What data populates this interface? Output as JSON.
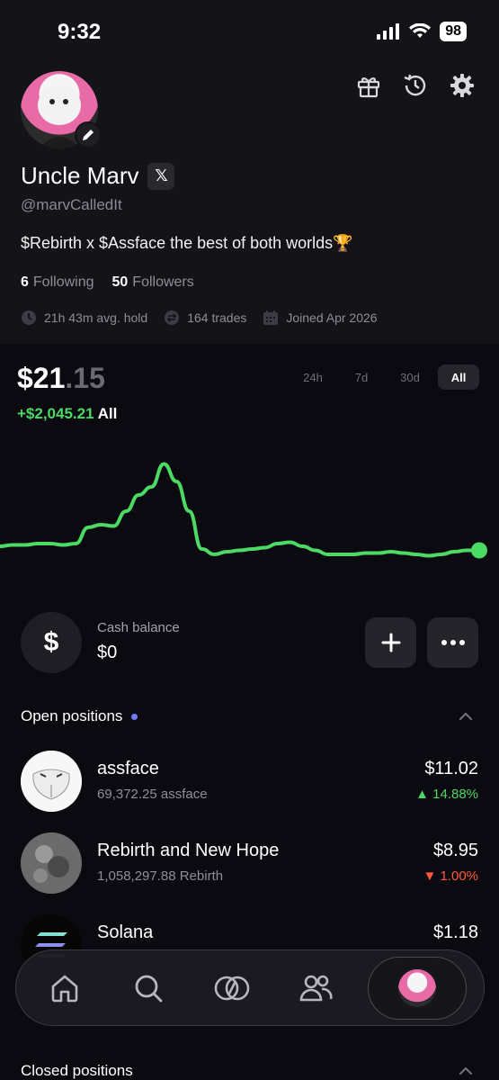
{
  "status_bar": {
    "time": "9:32",
    "battery": "98"
  },
  "profile": {
    "name": "Uncle Marv",
    "x_badge": "𝕏",
    "handle": "@marvCalledIt",
    "bio": "$Rebirth x $Assface the best of both worlds🏆",
    "following_count": "6",
    "following_label": "Following",
    "followers_count": "50",
    "followers_label": "Followers",
    "avg_hold": "21h 43m avg. hold",
    "trades": "164 trades",
    "joined": "Joined Apr 2026"
  },
  "portfolio": {
    "balance_main": "$21",
    "balance_cents": ".15",
    "gain_amount": "+$2,045.21",
    "gain_period": "All",
    "ranges": [
      "24h",
      "7d",
      "30d",
      "All"
    ],
    "active_range": "All",
    "line_color": "#4cd964"
  },
  "chart_data": {
    "type": "line",
    "title": "",
    "xlabel": "",
    "ylabel": "",
    "y": [
      14,
      15,
      15,
      16,
      16,
      15,
      16,
      28,
      30,
      29,
      40,
      52,
      58,
      75,
      62,
      40,
      12,
      8,
      10,
      11,
      12,
      13,
      16,
      17,
      14,
      11,
      8,
      8,
      8,
      9,
      9,
      10,
      9,
      8,
      7,
      8,
      10,
      11,
      11
    ],
    "ylim": [
      0,
      80
    ],
    "grid": false,
    "legend": false
  },
  "cash": {
    "icon_glyph": "$",
    "label": "Cash balance",
    "value": "$0"
  },
  "open_positions": {
    "title": "Open positions",
    "items": [
      {
        "name": "assface",
        "sub": "69,372.25 assface",
        "value": "$11.02",
        "change": "▲ 14.88%",
        "direction": "up"
      },
      {
        "name": "Rebirth and New Hope",
        "sub": "1,058,297.88 Rebirth",
        "value": "$8.95",
        "change": "▼ 1.00%",
        "direction": "down"
      },
      {
        "name": "Solana",
        "sub": "",
        "value": "$1.18",
        "change": "",
        "direction": "down"
      }
    ]
  },
  "closed_positions": {
    "title": "Closed positions"
  },
  "nav": {
    "items": [
      "home",
      "search",
      "trade",
      "people",
      "profile"
    ],
    "active": "profile"
  }
}
